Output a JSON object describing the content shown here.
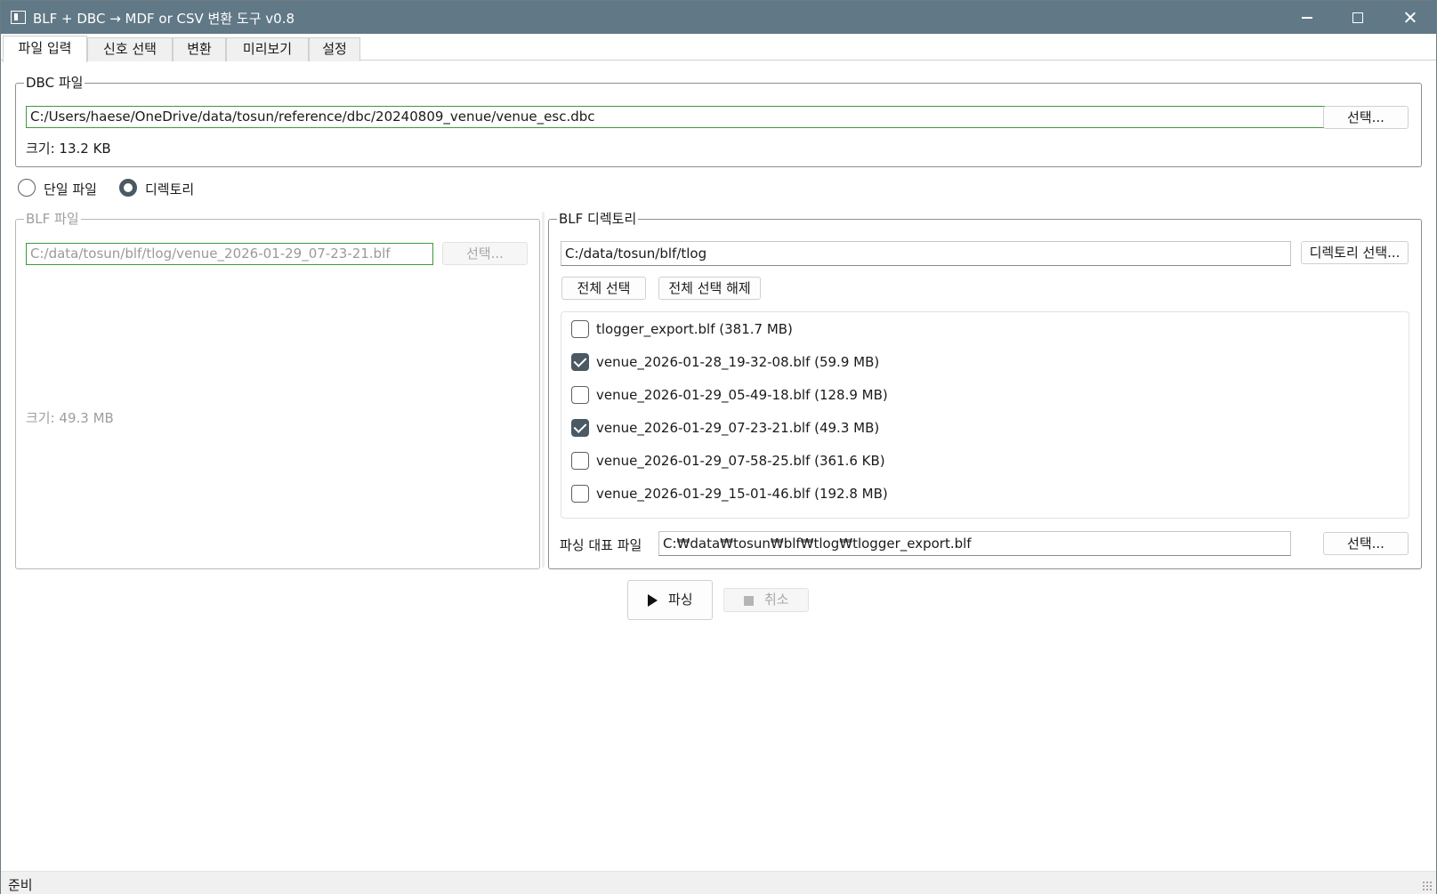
{
  "window": {
    "title": "BLF + DBC → MDF or CSV 변환 도구 v0.8"
  },
  "tabs": [
    {
      "label": "파일 입력",
      "active": true
    },
    {
      "label": "신호 선택",
      "active": false
    },
    {
      "label": "변환",
      "active": false
    },
    {
      "label": "미리보기",
      "active": false
    },
    {
      "label": "설정",
      "active": false
    }
  ],
  "dbc": {
    "group_title": "DBC 파일",
    "path": "C:/Users/haese/OneDrive/data/tosun/reference/dbc/20240809_venue/venue_esc.dbc",
    "select_label": "선택...",
    "size": "크기: 13.2 KB"
  },
  "mode": {
    "single_label": "단일 파일",
    "directory_label": "디렉토리",
    "selected": "directory"
  },
  "blf_file": {
    "group_title": "BLF 파일",
    "path": "C:/data/tosun/blf/tlog/venue_2026-01-29_07-23-21.blf",
    "select_label": "선택...",
    "size": "크기: 49.3 MB",
    "enabled": false
  },
  "blf_dir": {
    "group_title": "BLF 디렉토리",
    "path": "C:/data/tosun/blf/tlog",
    "select_dir_label": "디렉토리 선택...",
    "select_all_label": "전체 선택",
    "deselect_all_label": "전체 선택 해제",
    "files": [
      {
        "label": "tlogger_export.blf (381.7 MB)",
        "checked": false
      },
      {
        "label": "venue_2026-01-28_19-32-08.blf (59.9 MB)",
        "checked": true
      },
      {
        "label": "venue_2026-01-29_05-49-18.blf (128.9 MB)",
        "checked": false
      },
      {
        "label": "venue_2026-01-29_07-23-21.blf (49.3 MB)",
        "checked": true
      },
      {
        "label": "venue_2026-01-29_07-58-25.blf (361.6 KB)",
        "checked": false
      },
      {
        "label": "venue_2026-01-29_15-01-46.blf (192.8 MB)",
        "checked": false
      }
    ],
    "rep_label": "파싱 대표 파일",
    "rep_path": "C:₩data₩tosun₩blf₩tlog₩tlogger_export.blf",
    "rep_select_label": "선택..."
  },
  "actions": {
    "parse_label": "파싱",
    "cancel_label": "취소"
  },
  "status": {
    "text": "준비"
  },
  "icons": {
    "app": "app-window-icon",
    "play": "play-icon",
    "stop": "stop-icon"
  }
}
